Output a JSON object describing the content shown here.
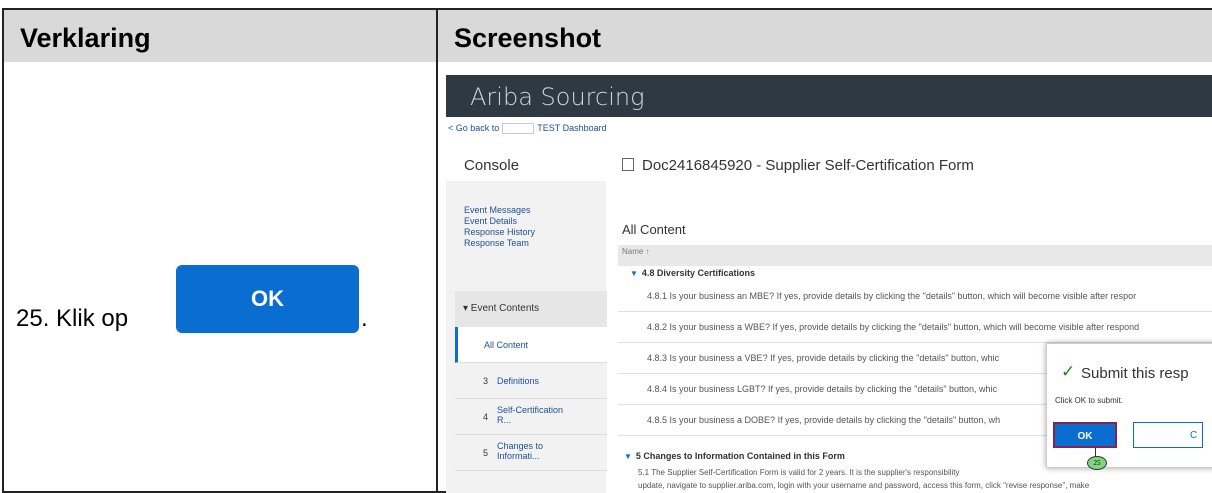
{
  "table": {
    "col1_header": "Verklaring",
    "col2_header": "Screenshot"
  },
  "instruction": {
    "text": "25. Klik op",
    "button_label": "OK",
    "suffix": "."
  },
  "screenshot": {
    "brand": "Ariba Sourcing",
    "back_link_prefix": "< Go back to",
    "back_link_suffix": "TEST Dashboard",
    "console": "Console",
    "doc_title": "Doc2416845920 - Supplier Self-Certification Form",
    "side_links": [
      "Event Messages",
      "Event Details",
      "Response History",
      "Response Team"
    ],
    "event_contents": "▾ Event Contents",
    "side_items": [
      {
        "num": "",
        "label": "All Content"
      },
      {
        "num": "3",
        "label": "Definitions"
      },
      {
        "num": "4",
        "label": "Self-Certification R..."
      },
      {
        "num": "5",
        "label": "Changes to Informati..."
      }
    ],
    "content_title": "All Content",
    "name_header": "Name ↑",
    "section_48": "4.8  Diversity Certifications",
    "questions": [
      "4.8.1  Is your business an MBE? If yes, provide details by clicking the \"details\" button, which will become visible after respor",
      "4.8.2  Is your business a WBE? If yes, provide details by clicking the \"details\" button, which will become visible after respond",
      "4.8.3  Is your business a VBE? If yes, provide details by clicking the \"details\" button, whic",
      "4.8.4  Is your business LGBT? If yes, provide details by clicking the \"details\" button, whic",
      "4.8.5  Is your business a DOBE? If yes, provide details by clicking the \"details\" button, wh"
    ],
    "section_5": "5   Changes to Information Contained in this Form",
    "para_5_1": "5.1  The Supplier Self-Certification Form is valid for 2 years. It is the supplier's responsibility",
    "para_5_1_b": "update, navigate to supplier.ariba.com, login with your username and password, access this form, click \"revise response\", make",
    "dialog": {
      "title": "Submit this resp",
      "text": "Click OK to submit.",
      "ok": "OK",
      "cancel": "C",
      "callout": "25"
    }
  }
}
